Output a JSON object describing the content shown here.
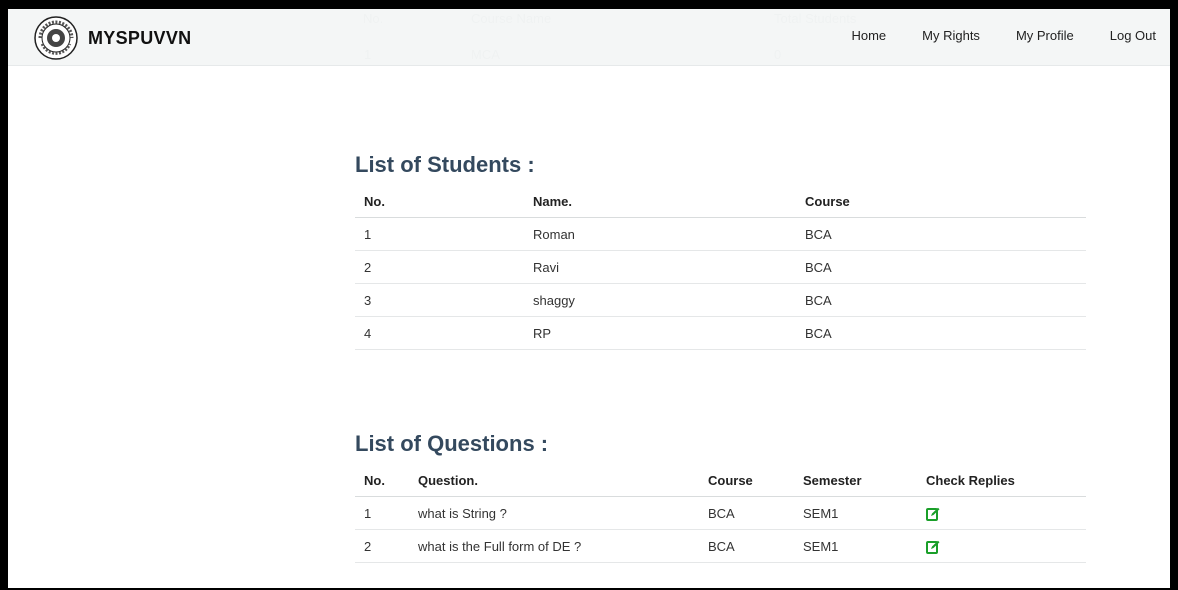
{
  "navbar": {
    "brand": "MYSPUVVN",
    "links": [
      "Home",
      "My Rights",
      "My Profile",
      "Log Out"
    ]
  },
  "ghost_table": {
    "headers": [
      "No.",
      "Course Name",
      "Total Students"
    ],
    "row": [
      "1",
      "MCA",
      "0"
    ]
  },
  "students": {
    "title": "List of Students :",
    "headers": [
      "No.",
      "Name.",
      "Course"
    ],
    "rows": [
      [
        "1",
        "Roman",
        "BCA"
      ],
      [
        "2",
        "Ravi",
        "BCA"
      ],
      [
        "3",
        "shaggy",
        "BCA"
      ],
      [
        "4",
        "RP",
        "BCA"
      ]
    ]
  },
  "questions": {
    "title": "List of Questions :",
    "headers": [
      "No.",
      "Question.",
      "Course",
      "Semester",
      "Check Replies"
    ],
    "rows": [
      [
        "1",
        "what is String ?",
        "BCA",
        "SEM1"
      ],
      [
        "2",
        "what is the Full form of DE ?",
        "BCA",
        "SEM1"
      ]
    ]
  },
  "colors": {
    "heading": "#34495e",
    "icon_green": "#1a9f29"
  },
  "icons": {
    "check_replies": "edit-icon"
  }
}
